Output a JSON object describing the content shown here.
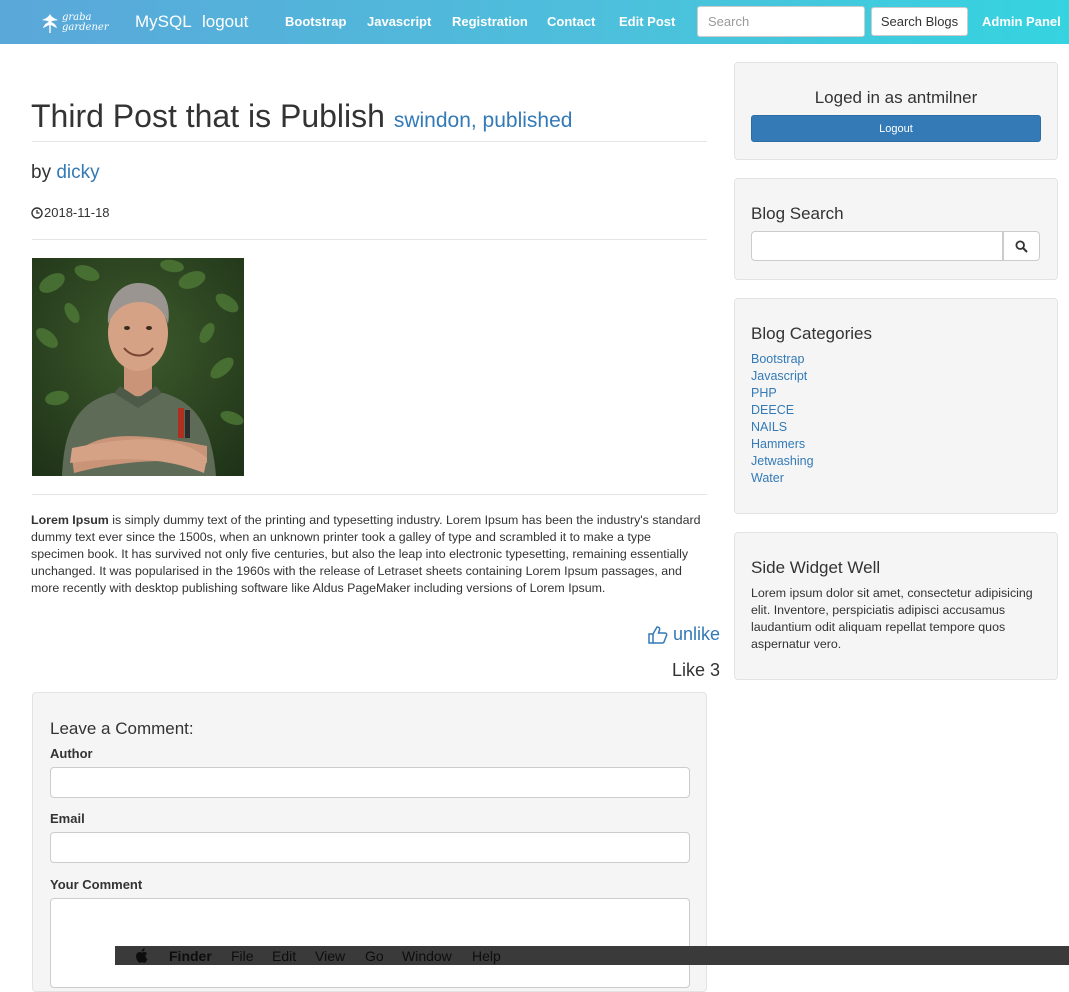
{
  "navbar": {
    "brand_text_line1": "graba",
    "brand_text_line2": "gardener",
    "mysql": "MySQL",
    "logout": "logout",
    "links": [
      "Bootstrap",
      "Javascript",
      "Registration",
      "Contact",
      "Edit Post"
    ],
    "search_placeholder": "Search",
    "search_button": "Search Blogs",
    "admin": "Admin Panel"
  },
  "post": {
    "title": "Third Post that is Publish",
    "tags": "swindon, published",
    "by": "by",
    "author": "dicky",
    "date": "2018-11-18",
    "body_bold": "Lorem Ipsum",
    "body": " is simply dummy text of the printing and typesetting industry. Lorem Ipsum has been the industry's standard dummy text ever since the 1500s, when an unknown printer took a galley of type and scrambled it to make a type specimen book. It has survived not only five centuries, but also the leap into electronic typesetting, remaining essentially unchanged. It was popularised in the 1960s with the release of Letraset sheets containing Lorem Ipsum passages, and more recently with desktop publishing software like Aldus PageMaker including versions of Lorem Ipsum.",
    "unlike": "unlike",
    "like_count": "Like 3"
  },
  "comment_form": {
    "title": "Leave a Comment:",
    "author_label": "Author",
    "email_label": "Email",
    "comment_label": "Your Comment"
  },
  "sidebar": {
    "login_status": "Loged in as antmilner",
    "logout_button": "Logout",
    "search_title": "Blog Search",
    "categories_title": "Blog Categories",
    "categories": [
      "Bootstrap",
      "Javascript",
      "PHP",
      "DEECE",
      "NAILS",
      "Hammers",
      "Jetwashing",
      "Water"
    ],
    "widget_title": "Side Widget Well",
    "widget_text": "Lorem ipsum dolor sit amet, consectetur adipisicing elit. Inventore, perspiciatis adipisci accusamus laudantium odit aliquam repellat tempore quos aspernatur vero."
  },
  "mac_menu": [
    "Finder",
    "File",
    "Edit",
    "View",
    "Go",
    "Window",
    "Help"
  ],
  "colors": {
    "link": "#337ab7",
    "navbar_start": "#5aa7d9",
    "navbar_end": "#35d3e0",
    "well_bg": "#f5f5f5"
  }
}
